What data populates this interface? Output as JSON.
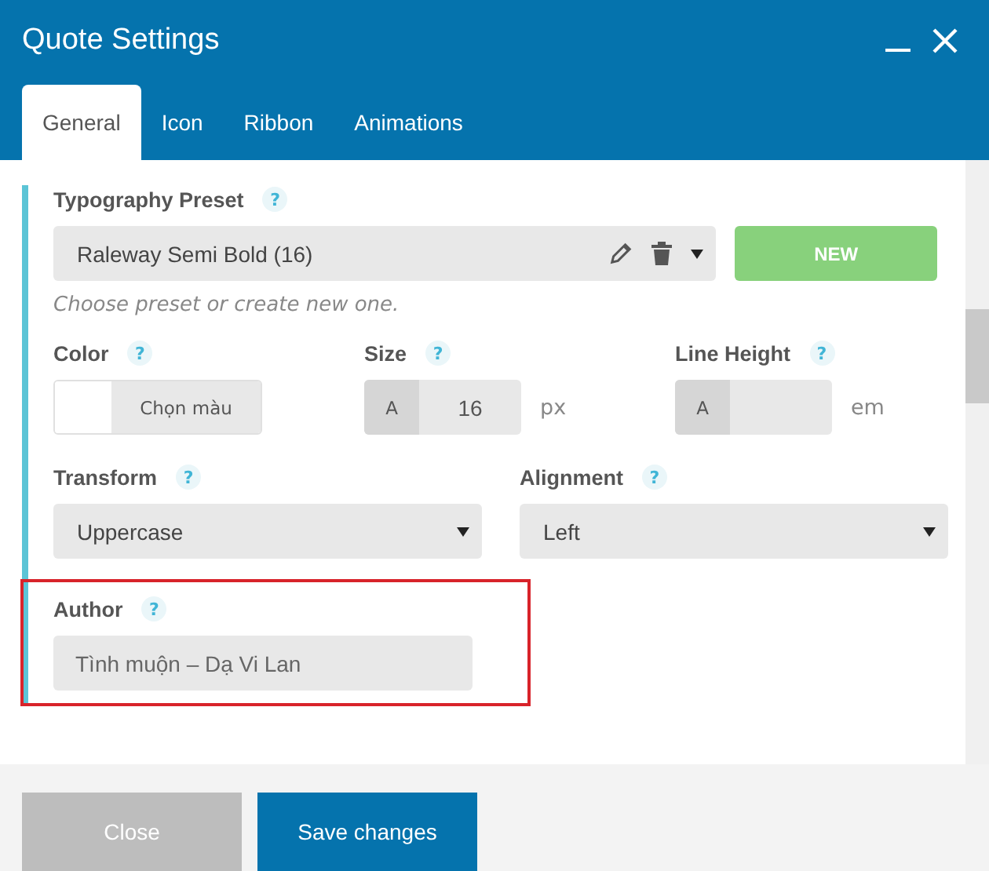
{
  "window": {
    "title": "Quote Settings"
  },
  "tabs": [
    {
      "label": "General",
      "selected": true
    },
    {
      "label": "Icon",
      "selected": false
    },
    {
      "label": "Ribbon",
      "selected": false
    },
    {
      "label": "Animations",
      "selected": false
    }
  ],
  "typography_preset": {
    "label": "Typography Preset",
    "help": "?",
    "value": "Raleway Semi Bold (16)",
    "new_button": "NEW",
    "hint": "Choose preset or create new one."
  },
  "color": {
    "label": "Color",
    "help": "?",
    "button": "Chọn màu"
  },
  "size": {
    "label": "Size",
    "help": "?",
    "prefix": "A",
    "value": "16",
    "unit": "px"
  },
  "line_height": {
    "label": "Line Height",
    "help": "?",
    "prefix": "A",
    "unit": "em"
  },
  "transform": {
    "label": "Transform",
    "help": "?",
    "value": "Uppercase"
  },
  "alignment": {
    "label": "Alignment",
    "help": "?",
    "value": "Left"
  },
  "author": {
    "label": "Author",
    "help": "?",
    "value": "Tình muộn – Dạ Vi Lan",
    "highlighted": true
  },
  "buttons": [
    {
      "label": "Close",
      "kind": "secondary"
    },
    {
      "label": "Save changes",
      "kind": "primary"
    }
  ]
}
